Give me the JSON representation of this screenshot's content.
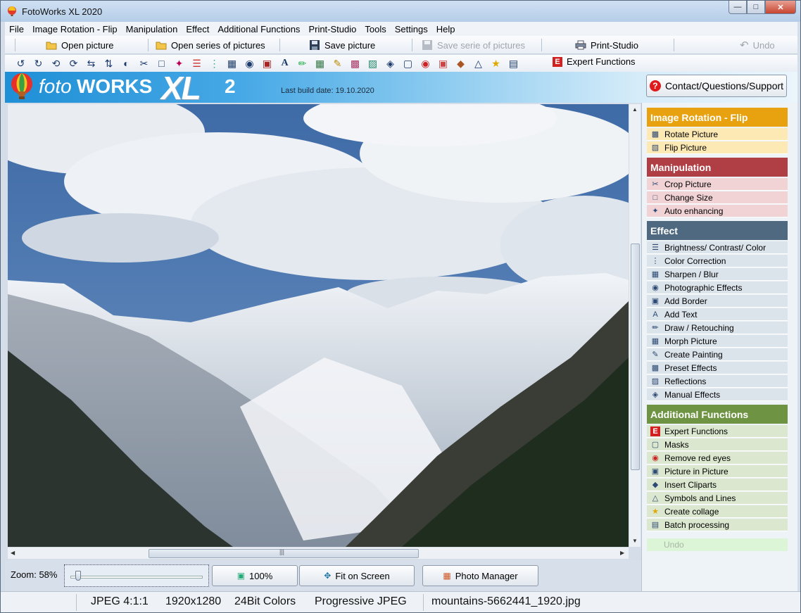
{
  "window": {
    "title": "FotoWorks XL 2020"
  },
  "menu": [
    {
      "label": "File"
    },
    {
      "label": "Image Rotation - Flip"
    },
    {
      "label": "Manipulation"
    },
    {
      "label": "Effect"
    },
    {
      "label": "Additional Functions"
    },
    {
      "label": "Print-Studio"
    },
    {
      "label": "Tools"
    },
    {
      "label": "Settings"
    },
    {
      "label": "Help"
    }
  ],
  "toolbar": {
    "open_picture": "Open picture",
    "open_series": "Open series of pictures",
    "save_picture": "Save picture",
    "save_serie": "Save serie of pictures",
    "print_studio": "Print-Studio",
    "undo": "Undo",
    "expert_functions": "Expert Functions",
    "expert_badge": "E"
  },
  "brand": {
    "foto": "foto",
    "works": "WORKS",
    "xl": "XL",
    "version": "2",
    "build_date": "Last build date: 19.10.2020",
    "contact": "Contact/Questions/Support",
    "contact_badge": "?"
  },
  "canvas": {
    "scroll_grip": "|||"
  },
  "bottom": {
    "zoom_label": "Zoom: 58%",
    "zoom_fraction": 0.04,
    "btn_100": "100%",
    "btn_fit": "Fit on Screen",
    "btn_manager": "Photo Manager"
  },
  "sidepanel": {
    "sections": [
      {
        "title": "Image Rotation - Flip",
        "color": "#e8a10f",
        "item_bg": "#fde9b4",
        "items": [
          "Rotate Picture",
          "Flip Picture"
        ]
      },
      {
        "title": "Manipulation",
        "color": "#b03e45",
        "item_bg": "#f1d3d6",
        "items": [
          "Crop Picture",
          "Change Size",
          "Auto enhancing"
        ]
      },
      {
        "title": "Effect",
        "color": "#4f6a80",
        "item_bg": "#dbe3eb",
        "items": [
          "Brightness/ Contrast/ Color",
          "Color Correction",
          "Sharpen / Blur",
          "Photographic Effects",
          "Add Border",
          "Add Text",
          "Draw / Retouching",
          "Morph Picture",
          "Create Painting",
          "Preset Effects",
          "Reflections",
          "Manual Effects"
        ]
      },
      {
        "title": "Additional Functions",
        "color": "#6e9443",
        "item_bg": "#dbe8cf",
        "items": [
          "Expert Functions",
          "Masks",
          "Remove red eyes",
          "Picture in Picture",
          "Insert Cliparts",
          "Symbols and Lines",
          "Create collage",
          "Batch processing"
        ]
      }
    ],
    "undo": "Undo"
  },
  "status": {
    "format": "JPEG  4:1:1",
    "size": "1920x1280",
    "colors": "24Bit Colors",
    "encoding": "Progressive JPEG",
    "filename": "mountains-5662441_1920.jpg"
  }
}
